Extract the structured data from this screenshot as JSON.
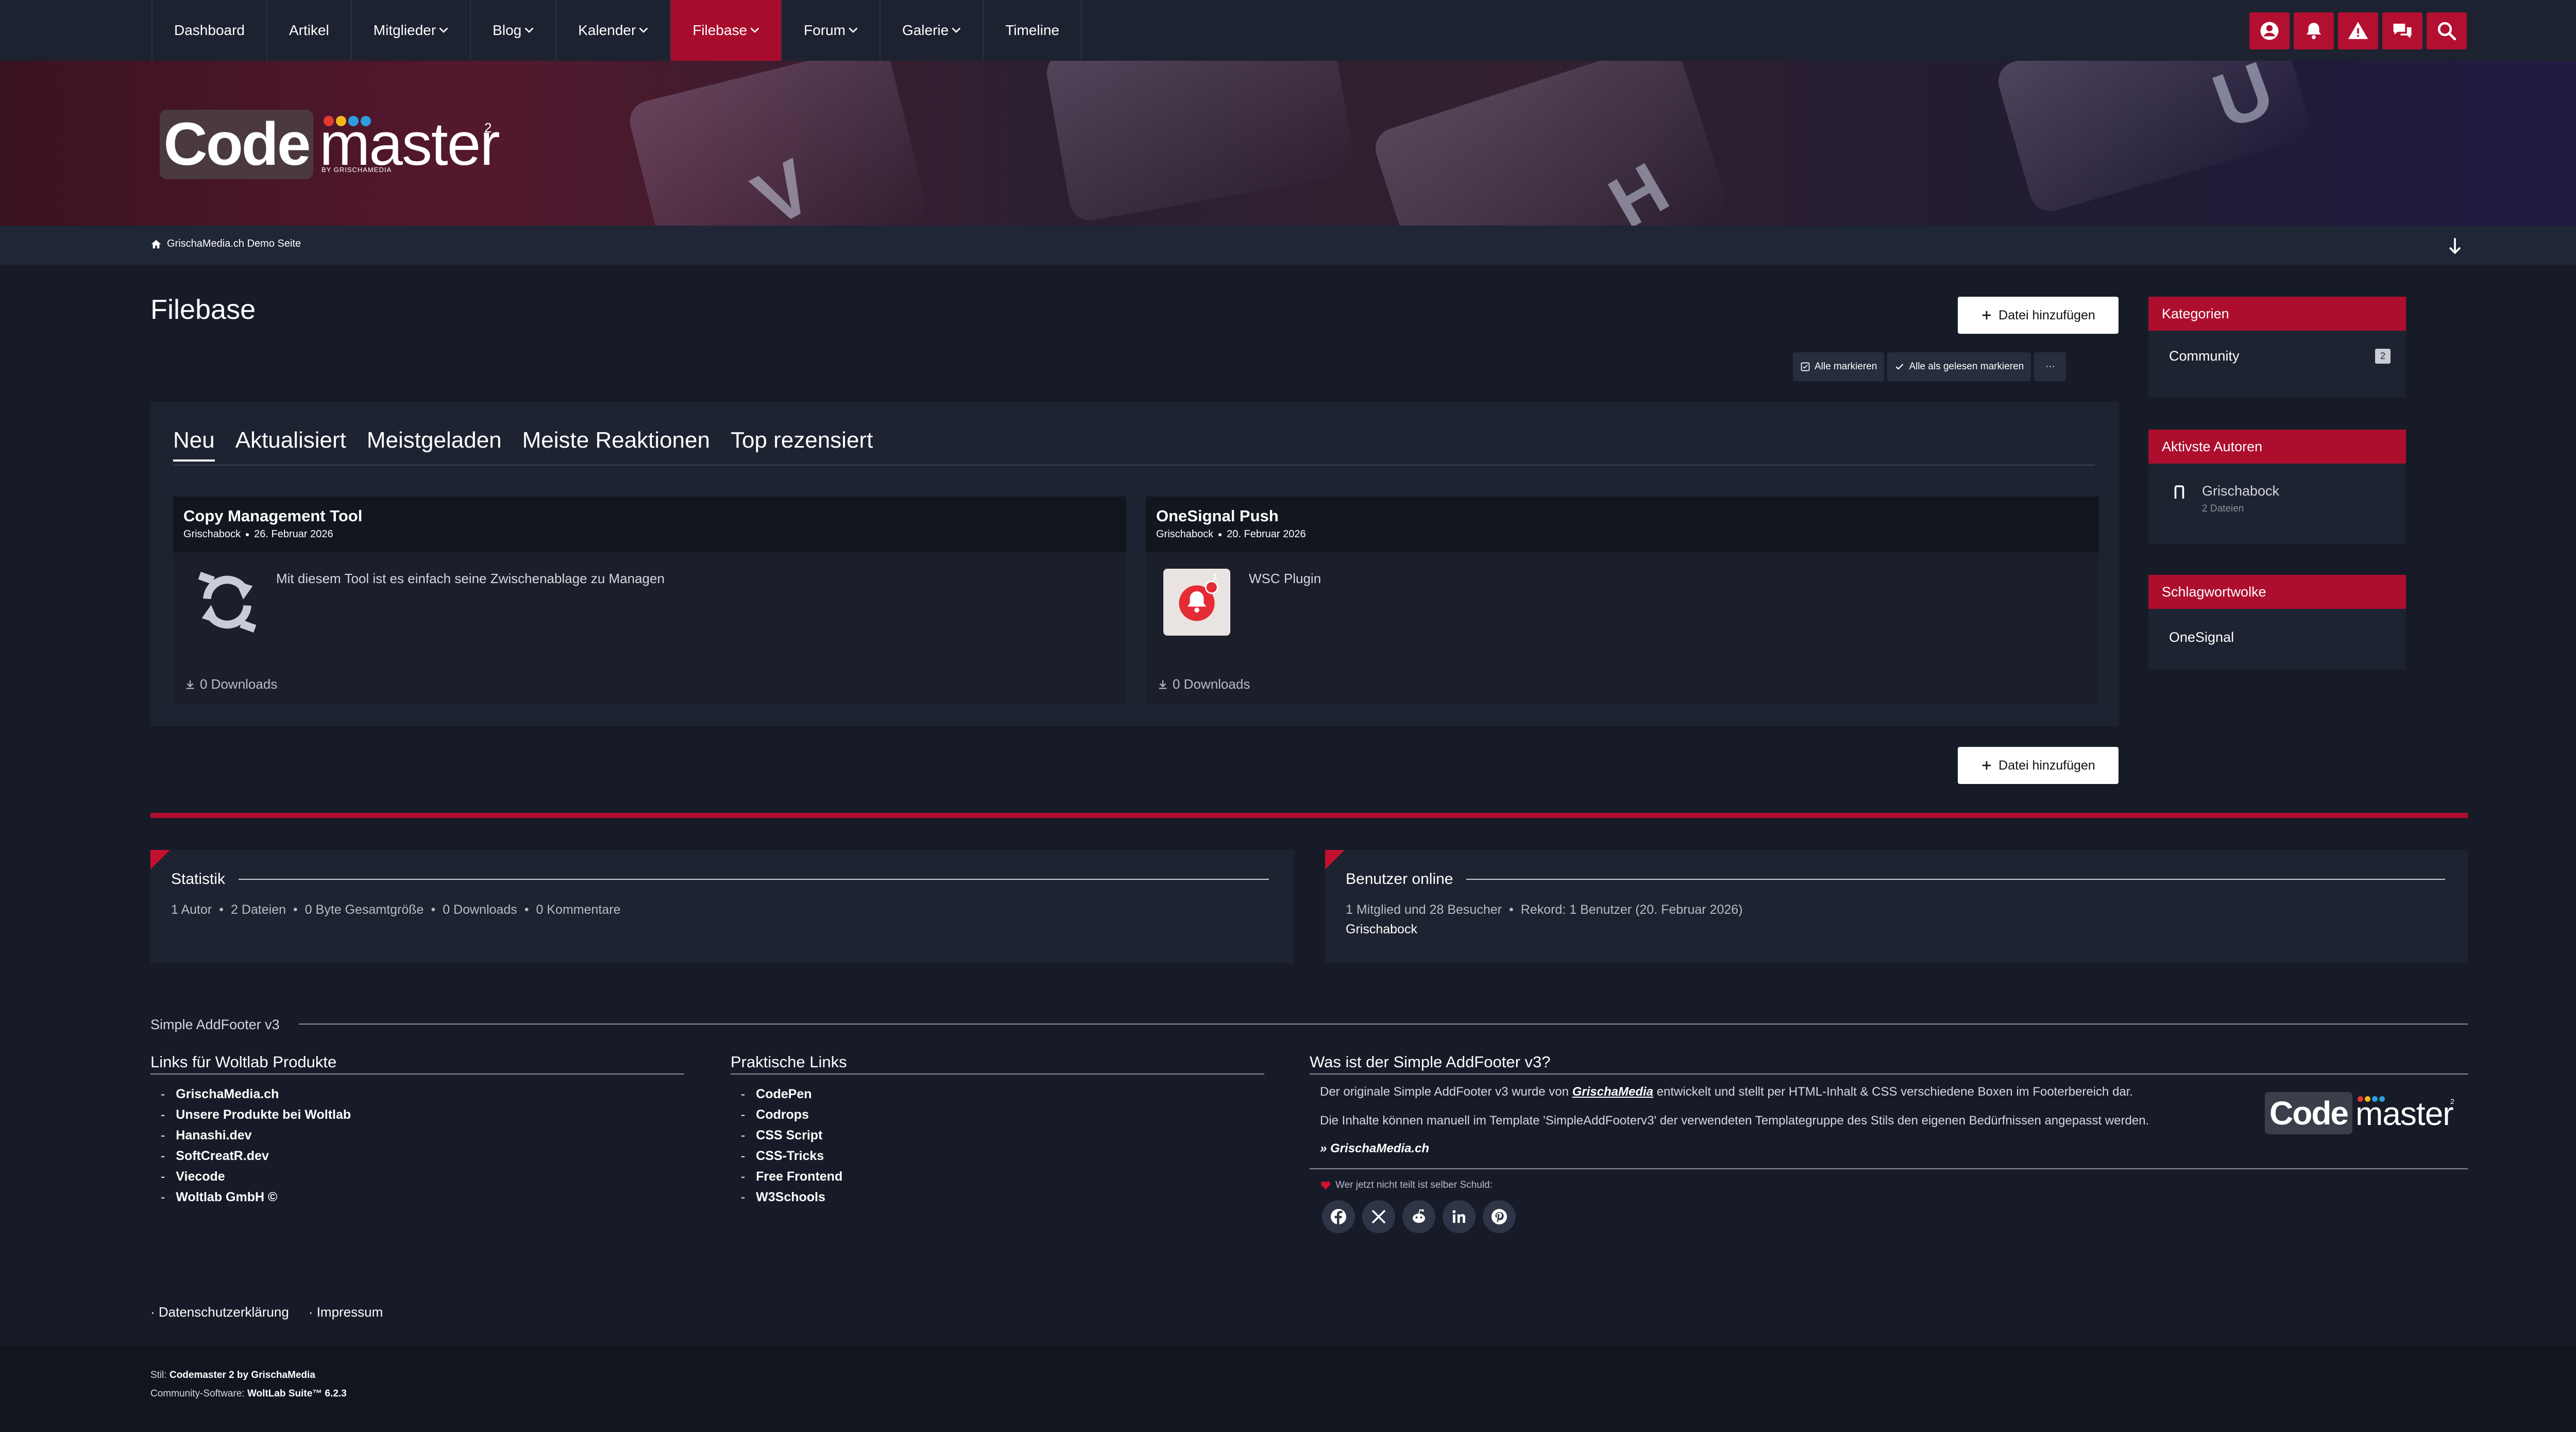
{
  "nav": {
    "items": [
      {
        "label": "Dashboard",
        "dropdown": false,
        "active": false
      },
      {
        "label": "Artikel",
        "dropdown": false,
        "active": false
      },
      {
        "label": "Mitglieder",
        "dropdown": true,
        "active": false
      },
      {
        "label": "Blog",
        "dropdown": true,
        "active": false
      },
      {
        "label": "Kalender",
        "dropdown": true,
        "active": false
      },
      {
        "label": "Filebase",
        "dropdown": true,
        "active": true
      },
      {
        "label": "Forum",
        "dropdown": true,
        "active": false
      },
      {
        "label": "Galerie",
        "dropdown": true,
        "active": false
      },
      {
        "label": "Timeline",
        "dropdown": false,
        "active": false
      }
    ],
    "icons": [
      "user-icon",
      "bell-icon",
      "warning-icon",
      "chat-icon",
      "search-icon"
    ]
  },
  "logo": {
    "code": "Code",
    "master": "master",
    "sup": "2",
    "sub": "BY GRISCHAMEDIA"
  },
  "breadcrumb": {
    "label": "GrischaMedia.ch Demo Seite"
  },
  "page": {
    "title": "Filebase",
    "add_file": "Datei hinzufügen",
    "mark_all": "Alle markieren",
    "mark_read": "Alle als gelesen markieren",
    "more": "···"
  },
  "tabs": [
    "Neu",
    "Aktualisiert",
    "Meistgeladen",
    "Meiste Reaktionen",
    "Top rezensiert"
  ],
  "files": [
    {
      "title": "Copy Management Tool",
      "author": "Grischabock",
      "date": "26. Februar 2026",
      "description": "Mit diesem Tool ist es einfach seine Zwischenablage zu Managen",
      "downloads": "0 Downloads",
      "icon": "sync-arrows-icon"
    },
    {
      "title": "OneSignal Push",
      "author": "Grischabock",
      "date": "20. Februar 2026",
      "description": "WSC Plugin",
      "downloads": "0 Downloads",
      "icon": "onesignal-bell-icon",
      "badge": "1"
    }
  ],
  "sidebar": {
    "categories": {
      "title": "Kategorien",
      "items": [
        {
          "label": "Community",
          "count": "2"
        }
      ]
    },
    "authors": {
      "title": "Aktivste Autoren",
      "items": [
        {
          "name": "Grischabock",
          "files": "2 Dateien"
        }
      ]
    },
    "tags": {
      "title": "Schlagwortwolke",
      "items": [
        "OneSignal"
      ]
    }
  },
  "stats": {
    "title": "Statistik",
    "items": [
      "1 Autor",
      "2 Dateien",
      "0 Byte Gesamtgröße",
      "0 Downloads",
      "0 Kommentare"
    ]
  },
  "online": {
    "title": "Benutzer online",
    "line": "1 Mitglied und 28 Besucher",
    "record": "Rekord: 1 Benutzer (20. Februar 2026)",
    "users": "Grischabock"
  },
  "addfooter": {
    "title": "Simple AddFooter v3",
    "col1": {
      "title": "Links für Woltlab Produkte",
      "links": [
        "GrischaMedia.ch",
        "Unsere Produkte bei Woltlab",
        "Hanashi.dev",
        "SoftCreatR.dev",
        "Viecode",
        "Woltlab GmbH ©"
      ]
    },
    "col2": {
      "title": "Praktische Links",
      "links": [
        "CodePen",
        "Codrops",
        "CSS Script",
        "CSS-Tricks",
        "Free Frontend",
        "W3Schools"
      ]
    },
    "col3": {
      "title": "Was ist der Simple AddFooter v3?",
      "p1_a": "Der originale Simple AddFooter v3 wurde von ",
      "p1_b": "GrischaMedia",
      "p1_c": " entwickelt und stellt per HTML-Inhalt & CSS verschiedene Boxen im Footerbereich dar.",
      "p2": "Die Inhalte können manuell im Template 'SimpleAddFooterv3' der verwendeten Templategruppe des Stils den eigenen Bedürfnissen angepasst werden.",
      "link": "» GrischaMedia.ch",
      "share": "Wer jetzt nicht teilt ist selber Schuld:",
      "social": [
        "facebook-icon",
        "x-icon",
        "reddit-icon",
        "linkedin-icon",
        "pinterest-icon"
      ]
    }
  },
  "legal": {
    "privacy": "Datenschutzerklärung",
    "imprint": "Impressum"
  },
  "copyright": {
    "style_label": "Stil:",
    "style_name": "Codemaster 2 by GrischaMedia",
    "software_label": "Community-Software:",
    "software_name": "WoltLab Suite™ 6.2.3"
  },
  "colors": {
    "accent": "#b00f31",
    "background": "#161b27",
    "panel": "#1d2330"
  }
}
